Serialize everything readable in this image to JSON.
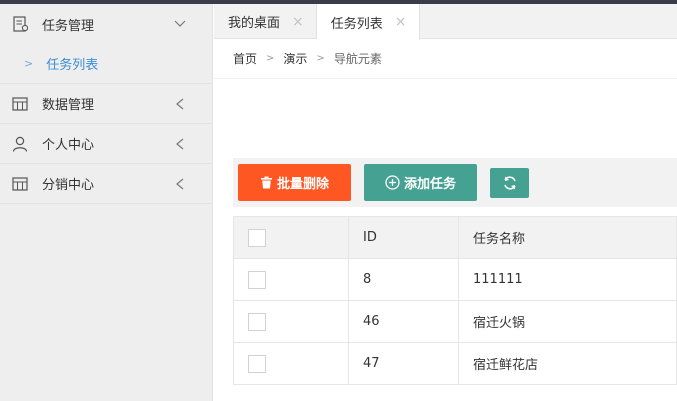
{
  "sidebar": {
    "items": [
      {
        "label": "任务管理",
        "icon": "task-icon",
        "expanded": true,
        "children": [
          {
            "label": "任务列表"
          }
        ]
      },
      {
        "label": "数据管理",
        "icon": "data-icon"
      },
      {
        "label": "个人中心",
        "icon": "user-icon"
      },
      {
        "label": "分销中心",
        "icon": "store-icon"
      }
    ]
  },
  "tabs": [
    {
      "label": "我的桌面",
      "close": "×"
    },
    {
      "label": "任务列表",
      "close": "×",
      "active": true
    }
  ],
  "breadcrumb": {
    "items": [
      "首页",
      "演示"
    ],
    "current": "导航元素",
    "separator": ">"
  },
  "toolbar": {
    "batch_delete_label": "批量删除",
    "add_task_label": "添加任务",
    "refresh_icon": "refresh-icon"
  },
  "table": {
    "columns": [
      "ID",
      "任务名称"
    ],
    "rows": [
      {
        "id": "8",
        "name": "111111"
      },
      {
        "id": "46",
        "name": "宿迁火锅"
      },
      {
        "id": "47",
        "name": "宿迁鲜花店"
      }
    ]
  },
  "colors": {
    "danger": "#ff5722",
    "primary": "#45a292",
    "link": "#3c8dd6",
    "sidebar_bg": "#eeeeee"
  }
}
